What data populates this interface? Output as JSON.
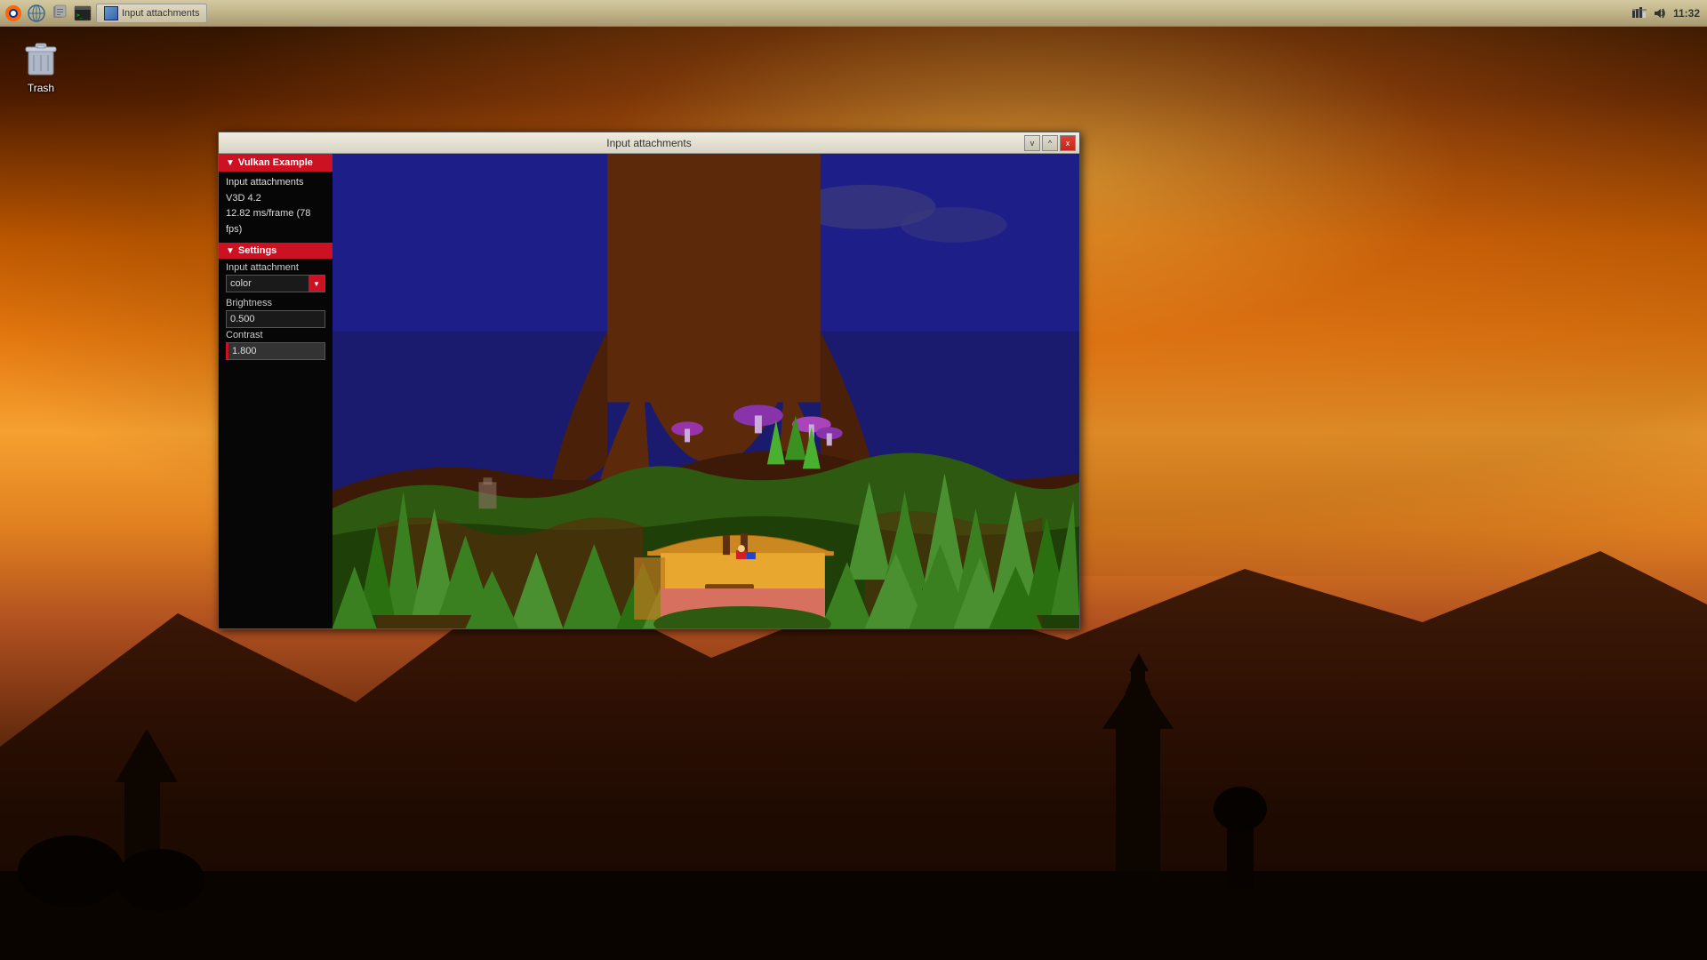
{
  "desktop": {
    "background_desc": "sunset orange sky with temple silhouettes"
  },
  "taskbar": {
    "time": "11:32",
    "window_title": "Input attachments",
    "icons": {
      "network": "network-icon",
      "volume": "volume-icon",
      "apps": "apps-icon",
      "files": "files-icon",
      "browser": "browser-icon"
    }
  },
  "trash": {
    "label": "Trash"
  },
  "window": {
    "title": "Input attachments",
    "controls": {
      "minimize": "v",
      "maximize": "^",
      "close": "x"
    },
    "panel": {
      "header": "Vulkan Example",
      "info_line1": "Input attachments",
      "info_line2": "V3D 4.2",
      "info_line3": "12.82 ms/frame (78 fps)",
      "settings_header": "Settings",
      "input_attachment_label": "Input attachment",
      "input_attachment_value": "color",
      "brightness_label": "Brightness",
      "brightness_value": "0.500",
      "contrast_label": "Contrast",
      "contrast_value": "1.800"
    }
  }
}
